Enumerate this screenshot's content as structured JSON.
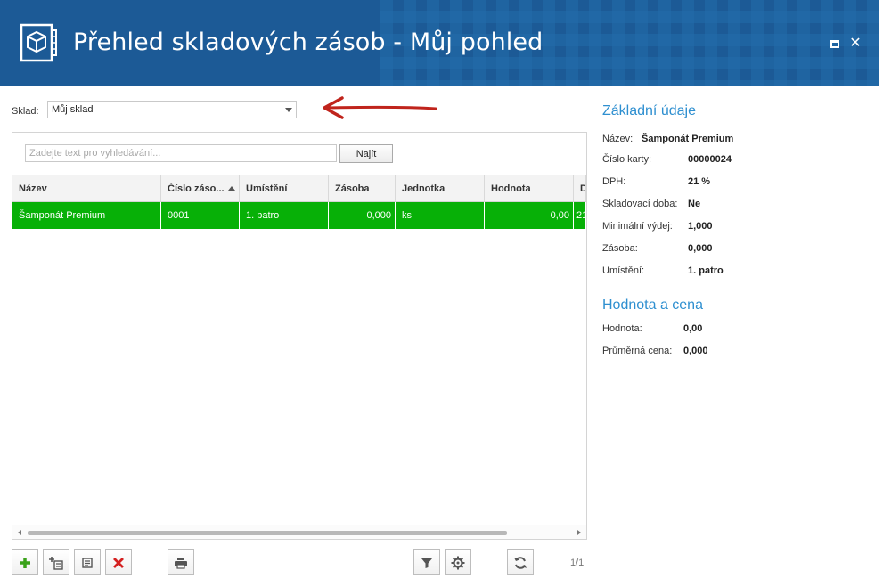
{
  "header": {
    "title": "Přehled skladových zásob - Můj pohled",
    "icons": {
      "app": "box-icon",
      "restore": "restore-icon",
      "close": "close-icon"
    },
    "close_glyph": "✕",
    "background": "#1c5a96"
  },
  "warehouse": {
    "label": "Sklad:",
    "value": "Můj sklad"
  },
  "search": {
    "placeholder": "Zadejte text pro vyhledávání...",
    "button_label": "Najít"
  },
  "grid": {
    "columns": [
      "Název",
      "Číslo záso...",
      "Umístění",
      "Zásoba",
      "Jednotka",
      "Hodnota",
      "D"
    ],
    "sorted_column": "Číslo záso...",
    "rows": [
      {
        "name": "Šamponát Premium",
        "number": "0001",
        "location": "1. patro",
        "stock": "0,000",
        "unit": "ks",
        "value": "0,00",
        "extra": "21"
      }
    ],
    "selected_row_color": "#07b007"
  },
  "toolbar": {
    "buttons": [
      "add-icon",
      "add-copy-icon",
      "edit-icon",
      "delete-icon",
      "print-icon",
      "filter-icon",
      "settings-icon",
      "refresh-icon"
    ],
    "page_info": "1/1"
  },
  "detail": {
    "basic_title": "Základní údaje",
    "basic": [
      {
        "label": "Název:",
        "value": "Šamponát Premium"
      },
      {
        "label": "Číslo karty:",
        "value": "00000024"
      },
      {
        "label": "DPH:",
        "value": "21 %"
      },
      {
        "label": "Skladovací doba:",
        "value": "Ne"
      },
      {
        "label": "Minimální výdej:",
        "value": "1,000"
      },
      {
        "label": "Zásoba:",
        "value": "0,000"
      },
      {
        "label": "Umístění:",
        "value": "1. patro"
      }
    ],
    "value_title": "Hodnota a cena",
    "value": [
      {
        "label": "Hodnota:",
        "value": "0,00"
      },
      {
        "label": "Průměrná cena:",
        "value": "0,000"
      }
    ],
    "accent": "#2e8fd0"
  }
}
